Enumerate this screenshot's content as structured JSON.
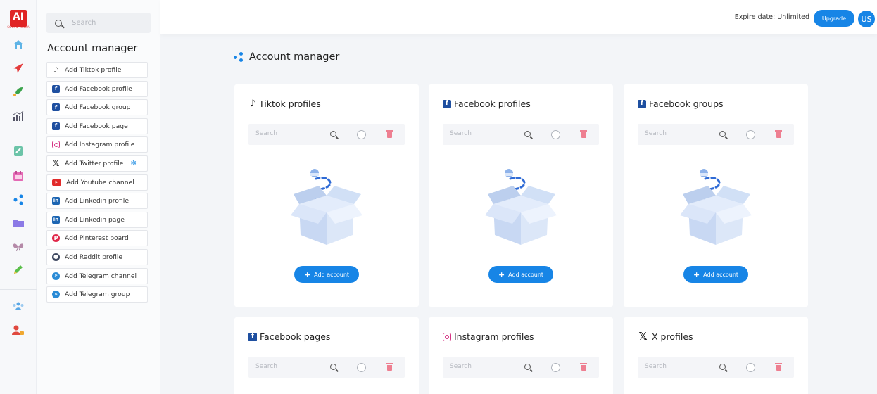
{
  "logo": {
    "mark": "AI",
    "subtitle": "SOCIAL MEDIA"
  },
  "rail": {
    "icons": [
      "home-icon",
      "send-icon",
      "rocket-icon",
      "analytics-icon",
      "document-icon",
      "calendar-icon",
      "share-icon",
      "folder-icon",
      "butterfly-icon",
      "edit-icon",
      "users-icon",
      "user-lock-icon"
    ]
  },
  "sidebar": {
    "search_placeholder": "Search",
    "title": "Account manager",
    "items": [
      {
        "label": "Add Tiktok profile",
        "icon": "tiktok-icon",
        "glyph": "♪"
      },
      {
        "label": "Add Facebook profile",
        "icon": "facebook-icon",
        "glyph": "f"
      },
      {
        "label": "Add Facebook group",
        "icon": "facebook-icon",
        "glyph": "f"
      },
      {
        "label": "Add Facebook page",
        "icon": "facebook-icon",
        "glyph": "f"
      },
      {
        "label": "Add Instagram profile",
        "icon": "instagram-icon",
        "glyph": ""
      },
      {
        "label": "Add Twitter profile",
        "icon": "x-icon",
        "glyph": "𝕏"
      },
      {
        "label": "Add Youtube channel",
        "icon": "youtube-icon",
        "glyph": "▶"
      },
      {
        "label": "Add Linkedin profile",
        "icon": "linkedin-icon",
        "glyph": "in"
      },
      {
        "label": "Add Linkedin page",
        "icon": "linkedin-icon",
        "glyph": "in"
      },
      {
        "label": "Add Pinterest board",
        "icon": "pinterest-icon",
        "glyph": "P"
      },
      {
        "label": "Add Reddit profile",
        "icon": "reddit-icon",
        "glyph": "●"
      },
      {
        "label": "Add Telegram channel",
        "icon": "telegram-icon",
        "glyph": "➤"
      },
      {
        "label": "Add Telegram group",
        "icon": "telegram-icon",
        "glyph": "➤"
      }
    ]
  },
  "header": {
    "expire_text": "Expire date: Unlimited",
    "upgrade_label": "Upgrade",
    "avatar_initials": "US"
  },
  "main": {
    "title": "Account manager",
    "search_placeholder": "Search",
    "add_account_label": "Add account",
    "cards": [
      {
        "title": "Tiktok profiles",
        "icon": "tiktok-icon",
        "glyph": "♪"
      },
      {
        "title": "Facebook profiles",
        "icon": "facebook-icon",
        "glyph": "f"
      },
      {
        "title": "Facebook groups",
        "icon": "facebook-icon",
        "glyph": "f"
      },
      {
        "title": "Facebook pages",
        "icon": "facebook-icon",
        "glyph": "f"
      },
      {
        "title": "Instagram profiles",
        "icon": "instagram-icon",
        "glyph": ""
      },
      {
        "title": "X profiles",
        "icon": "x-icon",
        "glyph": "𝕏"
      }
    ]
  },
  "colors": {
    "accent": "#1785e6",
    "danger": "#ee7f91",
    "logo": "#e02424"
  }
}
